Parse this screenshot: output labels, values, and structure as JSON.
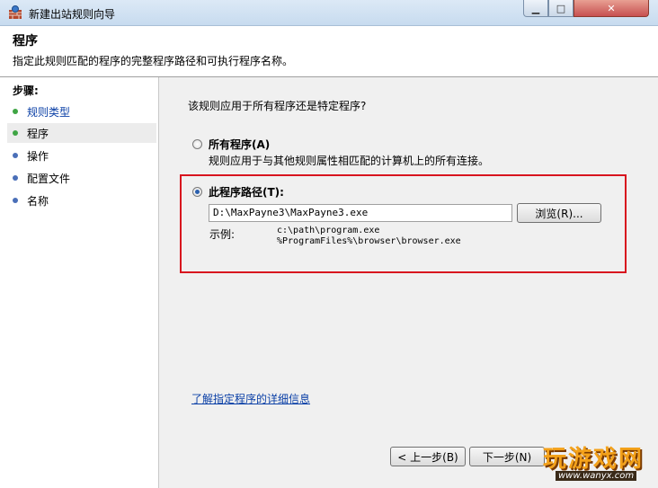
{
  "window": {
    "title": "新建出站规则向导"
  },
  "header": {
    "title": "程序",
    "description": "指定此规则匹配的程序的完整程序路径和可执行程序名称。"
  },
  "sidebar": {
    "heading": "步骤:",
    "steps": [
      {
        "label": "规则类型",
        "state": "done"
      },
      {
        "label": "程序",
        "state": "current"
      },
      {
        "label": "操作",
        "state": "pending"
      },
      {
        "label": "配置文件",
        "state": "pending"
      },
      {
        "label": "名称",
        "state": "pending"
      }
    ]
  },
  "main": {
    "question": "该规则应用于所有程序还是特定程序?",
    "option_all": {
      "label": "所有程序(A)",
      "description": "规则应用于与其他规则属性相匹配的计算机上的所有连接。",
      "selected": false
    },
    "option_path": {
      "label": "此程序路径(T):",
      "selected": true,
      "value": "D:\\MaxPayne3\\MaxPayne3.exe",
      "browse_label": "浏览(R)...",
      "example_label": "示例:",
      "example_line1": "c:\\path\\program.exe",
      "example_line2": "%ProgramFiles%\\browser\\browser.exe"
    },
    "learn_more_link": "了解指定程序的详细信息",
    "back_label": "< 上一步(B)",
    "next_label": "下一步(N)"
  },
  "watermark": {
    "text": "玩游戏网",
    "url": "www.wanyx.com"
  },
  "colors": {
    "highlight_border": "#d8141e",
    "link": "#0a3fa6",
    "done_dot": "#3fa544",
    "pending_dot": "#4a6fb8"
  }
}
